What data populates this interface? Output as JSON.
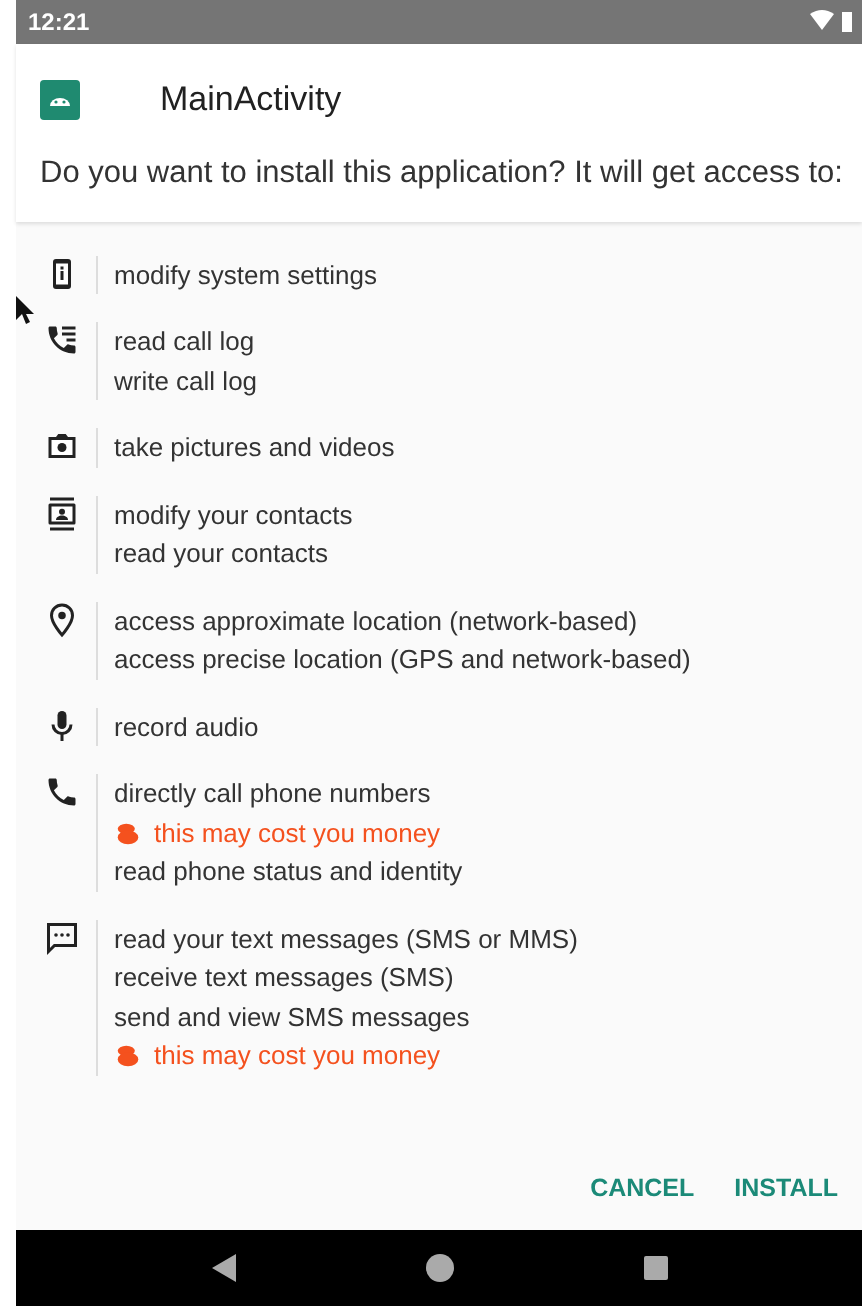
{
  "status_bar": {
    "time": "12:21"
  },
  "dialog": {
    "app_name": "MainActivity",
    "prompt": "Do you want to install this application? It will get access to:"
  },
  "permission_groups": [
    {
      "lines": [
        {
          "kind": "text",
          "text": "modify system settings"
        }
      ]
    },
    {
      "lines": [
        {
          "kind": "text",
          "text": "read call log"
        },
        {
          "kind": "text",
          "text": "write call log"
        }
      ]
    },
    {
      "lines": [
        {
          "kind": "text",
          "text": "take pictures and videos"
        }
      ]
    },
    {
      "lines": [
        {
          "kind": "text",
          "text": "modify your contacts"
        },
        {
          "kind": "text",
          "text": "read your contacts"
        }
      ]
    },
    {
      "lines": [
        {
          "kind": "text",
          "text": "access approximate location (network-based)"
        },
        {
          "kind": "text",
          "text": "access precise location (GPS and network-based)"
        }
      ]
    },
    {
      "lines": [
        {
          "kind": "text",
          "text": "record audio"
        }
      ]
    },
    {
      "lines": [
        {
          "kind": "text",
          "text": "directly call phone numbers"
        },
        {
          "kind": "cost",
          "text": "this may cost you money"
        },
        {
          "kind": "text",
          "text": "read phone status and identity"
        }
      ]
    },
    {
      "lines": [
        {
          "kind": "text",
          "text": "read your text messages (SMS or MMS)"
        },
        {
          "kind": "text",
          "text": "receive text messages (SMS)"
        },
        {
          "kind": "text",
          "text": "send and view SMS messages"
        },
        {
          "kind": "cost",
          "text": "this may cost you money"
        }
      ]
    }
  ],
  "buttons": [
    {
      "label": "CANCEL"
    },
    {
      "label": "INSTALL"
    }
  ]
}
